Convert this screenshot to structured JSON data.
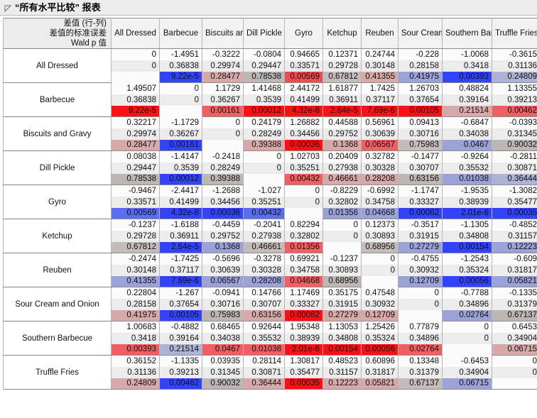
{
  "window": {
    "title": "“所有水平比较” 报表",
    "disclosure_icon": "triangle-collapse-icon"
  },
  "table": {
    "corner_header": {
      "line1": "差值 (行-列)",
      "line2": "差值的标准误差",
      "line3": "Wald p 值"
    },
    "columns": [
      "All Dressed",
      "Barbecue",
      "Biscuits and Gravy",
      "Dill Pickle",
      "Gyro",
      "Ketchup",
      "Reuben",
      "Sour Cream and Onion",
      "Southern Barbecue",
      "Truffle Fries"
    ],
    "rows": [
      {
        "label": "All Dressed",
        "diff": [
          "0",
          "-1.4951",
          "-0.3222",
          "-0.0804",
          "0.94665",
          "0.12371",
          "0.24744",
          "-0.228",
          "-1.0068",
          "-0.3615"
        ],
        "se": [
          "0",
          "0.36838",
          "0.29974",
          "0.29447",
          "0.33571",
          "0.29728",
          "0.30148",
          "0.28158",
          "0.3418",
          "0.31136"
        ],
        "p": [
          "",
          "9.22e-5",
          "0.28477",
          "0.78538",
          "0.00569",
          "0.67812",
          "0.41355",
          "0.41975",
          "0.00393",
          "0.24809"
        ],
        "p_fill": [
          "none",
          "blue-strong",
          "red-faint",
          "gray-mid",
          "red-strong",
          "gray-warm",
          "red-pale",
          "blue-pale",
          "blue-strong",
          "blue-faint"
        ]
      },
      {
        "label": "Barbecue",
        "diff": [
          "1.49507",
          "0",
          "1.1729",
          "1.41468",
          "2.44172",
          "1.61877",
          "1.7425",
          "1.26703",
          "0.48824",
          "1.13355"
        ],
        "se": [
          "0.36838",
          "0",
          "0.36267",
          "0.3539",
          "0.41499",
          "0.36911",
          "0.37117",
          "0.37654",
          "0.39164",
          "0.39213"
        ],
        "p": [
          "9.22e-5",
          "",
          "0.00161",
          "0.00012",
          "4.32e-8",
          "2.64e-5",
          "7.69e-6",
          "0.00105",
          "0.21514",
          "0.00462"
        ],
        "p_fill": [
          "red-full",
          "none",
          "red-mid",
          "red-full",
          "red-full",
          "red-full",
          "red-full",
          "red-full",
          "red-faint",
          "red-mid"
        ]
      },
      {
        "label": "Biscuits and Gravy",
        "diff": [
          "0.32217",
          "-1.1729",
          "0",
          "0.24179",
          "1.26882",
          "0.44588",
          "0.56961",
          "0.09413",
          "-0.6847",
          "-0.0393"
        ],
        "se": [
          "0.29974",
          "0.36267",
          "0",
          "0.28249",
          "0.34456",
          "0.29752",
          "0.30639",
          "0.30716",
          "0.34038",
          "0.31345"
        ],
        "p": [
          "0.28477",
          "0.00161",
          "",
          "0.39388",
          "0.00036",
          "0.1368",
          "0.06567",
          "0.75983",
          "0.0467",
          "0.90032"
        ],
        "p_fill": [
          "red-faint",
          "blue-strong",
          "none",
          "red-faint",
          "red-full",
          "red-faint",
          "red-mid",
          "gray-warm",
          "blue-pale",
          "gray-mid"
        ]
      },
      {
        "label": "Dill Pickle",
        "diff": [
          "0.08038",
          "-1.4147",
          "-0.2418",
          "0",
          "1.02703",
          "0.20409",
          "0.32782",
          "-0.1477",
          "-0.9264",
          "-0.2811"
        ],
        "se": [
          "0.29447",
          "0.3539",
          "0.28249",
          "0",
          "0.35251",
          "0.27938",
          "0.30328",
          "0.30707",
          "0.35532",
          "0.30871"
        ],
        "p": [
          "0.78538",
          "0.00012",
          "0.39388",
          "",
          "0.00432",
          "0.46661",
          "0.28208",
          "0.63156",
          "0.01038",
          "0.36444"
        ],
        "p_fill": [
          "gray-mid",
          "blue-strong",
          "gray-mid",
          "none",
          "red-mid",
          "red-faint",
          "red-faint",
          "gray-mid",
          "blue-pale",
          "blue-faint"
        ]
      },
      {
        "label": "Gyro",
        "diff": [
          "-0.9467",
          "-2.4417",
          "-1.2688",
          "-1.027",
          "0",
          "-0.8229",
          "-0.6992",
          "-1.1747",
          "-1.9535",
          "-1.3082"
        ],
        "se": [
          "0.33571",
          "0.41499",
          "0.34456",
          "0.35251",
          "0",
          "0.32802",
          "0.34758",
          "0.33327",
          "0.38939",
          "0.35477"
        ],
        "p": [
          "0.00569",
          "4.32e-8",
          "0.00036",
          "0.00432",
          "",
          "0.01356",
          "0.04668",
          "0.00062",
          "2.01e-6",
          "0.00035"
        ],
        "p_fill": [
          "blue-mid",
          "blue-strong",
          "blue-strong",
          "blue-mid",
          "none",
          "blue-pale",
          "blue-pale",
          "blue-strong",
          "blue-strong",
          "blue-strong"
        ]
      },
      {
        "label": "Ketchup",
        "diff": [
          "-0.1237",
          "-1.6188",
          "-0.4459",
          "-0.2041",
          "0.82294",
          "0",
          "0.12373",
          "-0.3517",
          "-1.1305",
          "-0.4852"
        ],
        "se": [
          "0.29728",
          "0.36911",
          "0.29752",
          "0.27938",
          "0.32802",
          "0",
          "0.30893",
          "0.31915",
          "0.34808",
          "0.31157"
        ],
        "p": [
          "0.67812",
          "2.64e-5",
          "0.1368",
          "0.46661",
          "0.01356",
          "",
          "0.68956",
          "0.27279",
          "0.00154",
          "0.12223"
        ],
        "p_fill": [
          "gray-warm",
          "blue-strong",
          "blue-pale",
          "gray-warm",
          "red-mid",
          "none",
          "gray-warm",
          "blue-pale",
          "blue-strong",
          "blue-pale"
        ]
      },
      {
        "label": "Reuben",
        "diff": [
          "-0.2474",
          "-1.7425",
          "-0.5696",
          "-0.3278",
          "0.69921",
          "-0.1237",
          "0",
          "-0.4755",
          "-1.2543",
          "-0.609"
        ],
        "se": [
          "0.30148",
          "0.37117",
          "0.30639",
          "0.30328",
          "0.34758",
          "0.30893",
          "0",
          "0.30932",
          "0.35324",
          "0.31817"
        ],
        "p": [
          "0.41355",
          "7.69e-6",
          "0.06567",
          "0.28208",
          "0.04668",
          "0.68956",
          "",
          "0.12709",
          "0.00056",
          "0.05821"
        ],
        "p_fill": [
          "blue-pale",
          "blue-strong",
          "blue-pale",
          "blue-pale",
          "red-mid",
          "gray-mid",
          "none",
          "blue-pale",
          "blue-strong",
          "blue-pale"
        ]
      },
      {
        "label": "Sour Cream and Onion",
        "diff": [
          "0.22804",
          "-1.267",
          "-0.0941",
          "0.14766",
          "1.17469",
          "0.35175",
          "0.47548",
          "0",
          "-0.7788",
          "-0.1335"
        ],
        "se": [
          "0.28158",
          "0.37654",
          "0.30716",
          "0.30707",
          "0.33327",
          "0.31915",
          "0.30932",
          "0",
          "0.34896",
          "0.31379"
        ],
        "p": [
          "0.41975",
          "0.00105",
          "0.75983",
          "0.63156",
          "0.00062",
          "0.27279",
          "0.12709",
          "",
          "0.02764",
          "0.67137"
        ],
        "p_fill": [
          "red-faint",
          "blue-strong",
          "gray-mid",
          "red-faint",
          "red-full",
          "red-faint",
          "red-faint",
          "none",
          "blue-pale",
          "gray-mid"
        ]
      },
      {
        "label": "Southern Barbecue",
        "diff": [
          "1.00683",
          "-0.4882",
          "0.68465",
          "0.92644",
          "1.95348",
          "1.13053",
          "1.25426",
          "0.77879",
          "0",
          "0.6453"
        ],
        "se": [
          "0.3418",
          "0.39164",
          "0.34038",
          "0.35532",
          "0.38939",
          "0.34808",
          "0.35324",
          "0.34896",
          "0",
          "0.34904"
        ],
        "p": [
          "0.00393",
          "0.21514",
          "0.0467",
          "0.01038",
          "2.01e-6",
          "0.00154",
          "0.00056",
          "0.02764",
          "",
          "0.06715"
        ],
        "p_fill": [
          "red-mid",
          "blue-faint",
          "red-mid",
          "red-mid",
          "red-full",
          "red-full",
          "red-full",
          "red-mid",
          "none",
          "red-faint"
        ]
      },
      {
        "label": "Truffle Fries",
        "diff": [
          "0.36152",
          "-1.1335",
          "0.03935",
          "0.28114",
          "1.30817",
          "0.48523",
          "0.60896",
          "0.13348",
          "-0.6453",
          "0"
        ],
        "se": [
          "0.31136",
          "0.39213",
          "0.31345",
          "0.30871",
          "0.35477",
          "0.31157",
          "0.31817",
          "0.31379",
          "0.34904",
          "0"
        ],
        "p": [
          "0.24809",
          "0.00462",
          "0.90032",
          "0.36444",
          "0.00035",
          "0.12223",
          "0.05821",
          "0.67137",
          "0.06715",
          ""
        ],
        "p_fill": [
          "red-faint",
          "blue-strong",
          "gray-mid",
          "red-faint",
          "red-full",
          "red-faint",
          "red-faint",
          "gray-warm",
          "blue-pale",
          "none"
        ]
      }
    ]
  },
  "colors": {
    "red_full": "#fd0f14",
    "red_strong": "#ef4b4f",
    "red_mid": "#f15f63",
    "red_faint": "#d9a8a8",
    "blue_full": "#2030fb",
    "blue_strong": "#3244fb",
    "blue_mid": "#5a6ef2",
    "blue_pale": "#9aa2d8",
    "blue_faint": "#adb3d6",
    "gray_mid": "#bcb7b5",
    "gray_warm": "#c4bcba",
    "header_bg": "#f2f2f2",
    "title_bg": "#ececed"
  }
}
